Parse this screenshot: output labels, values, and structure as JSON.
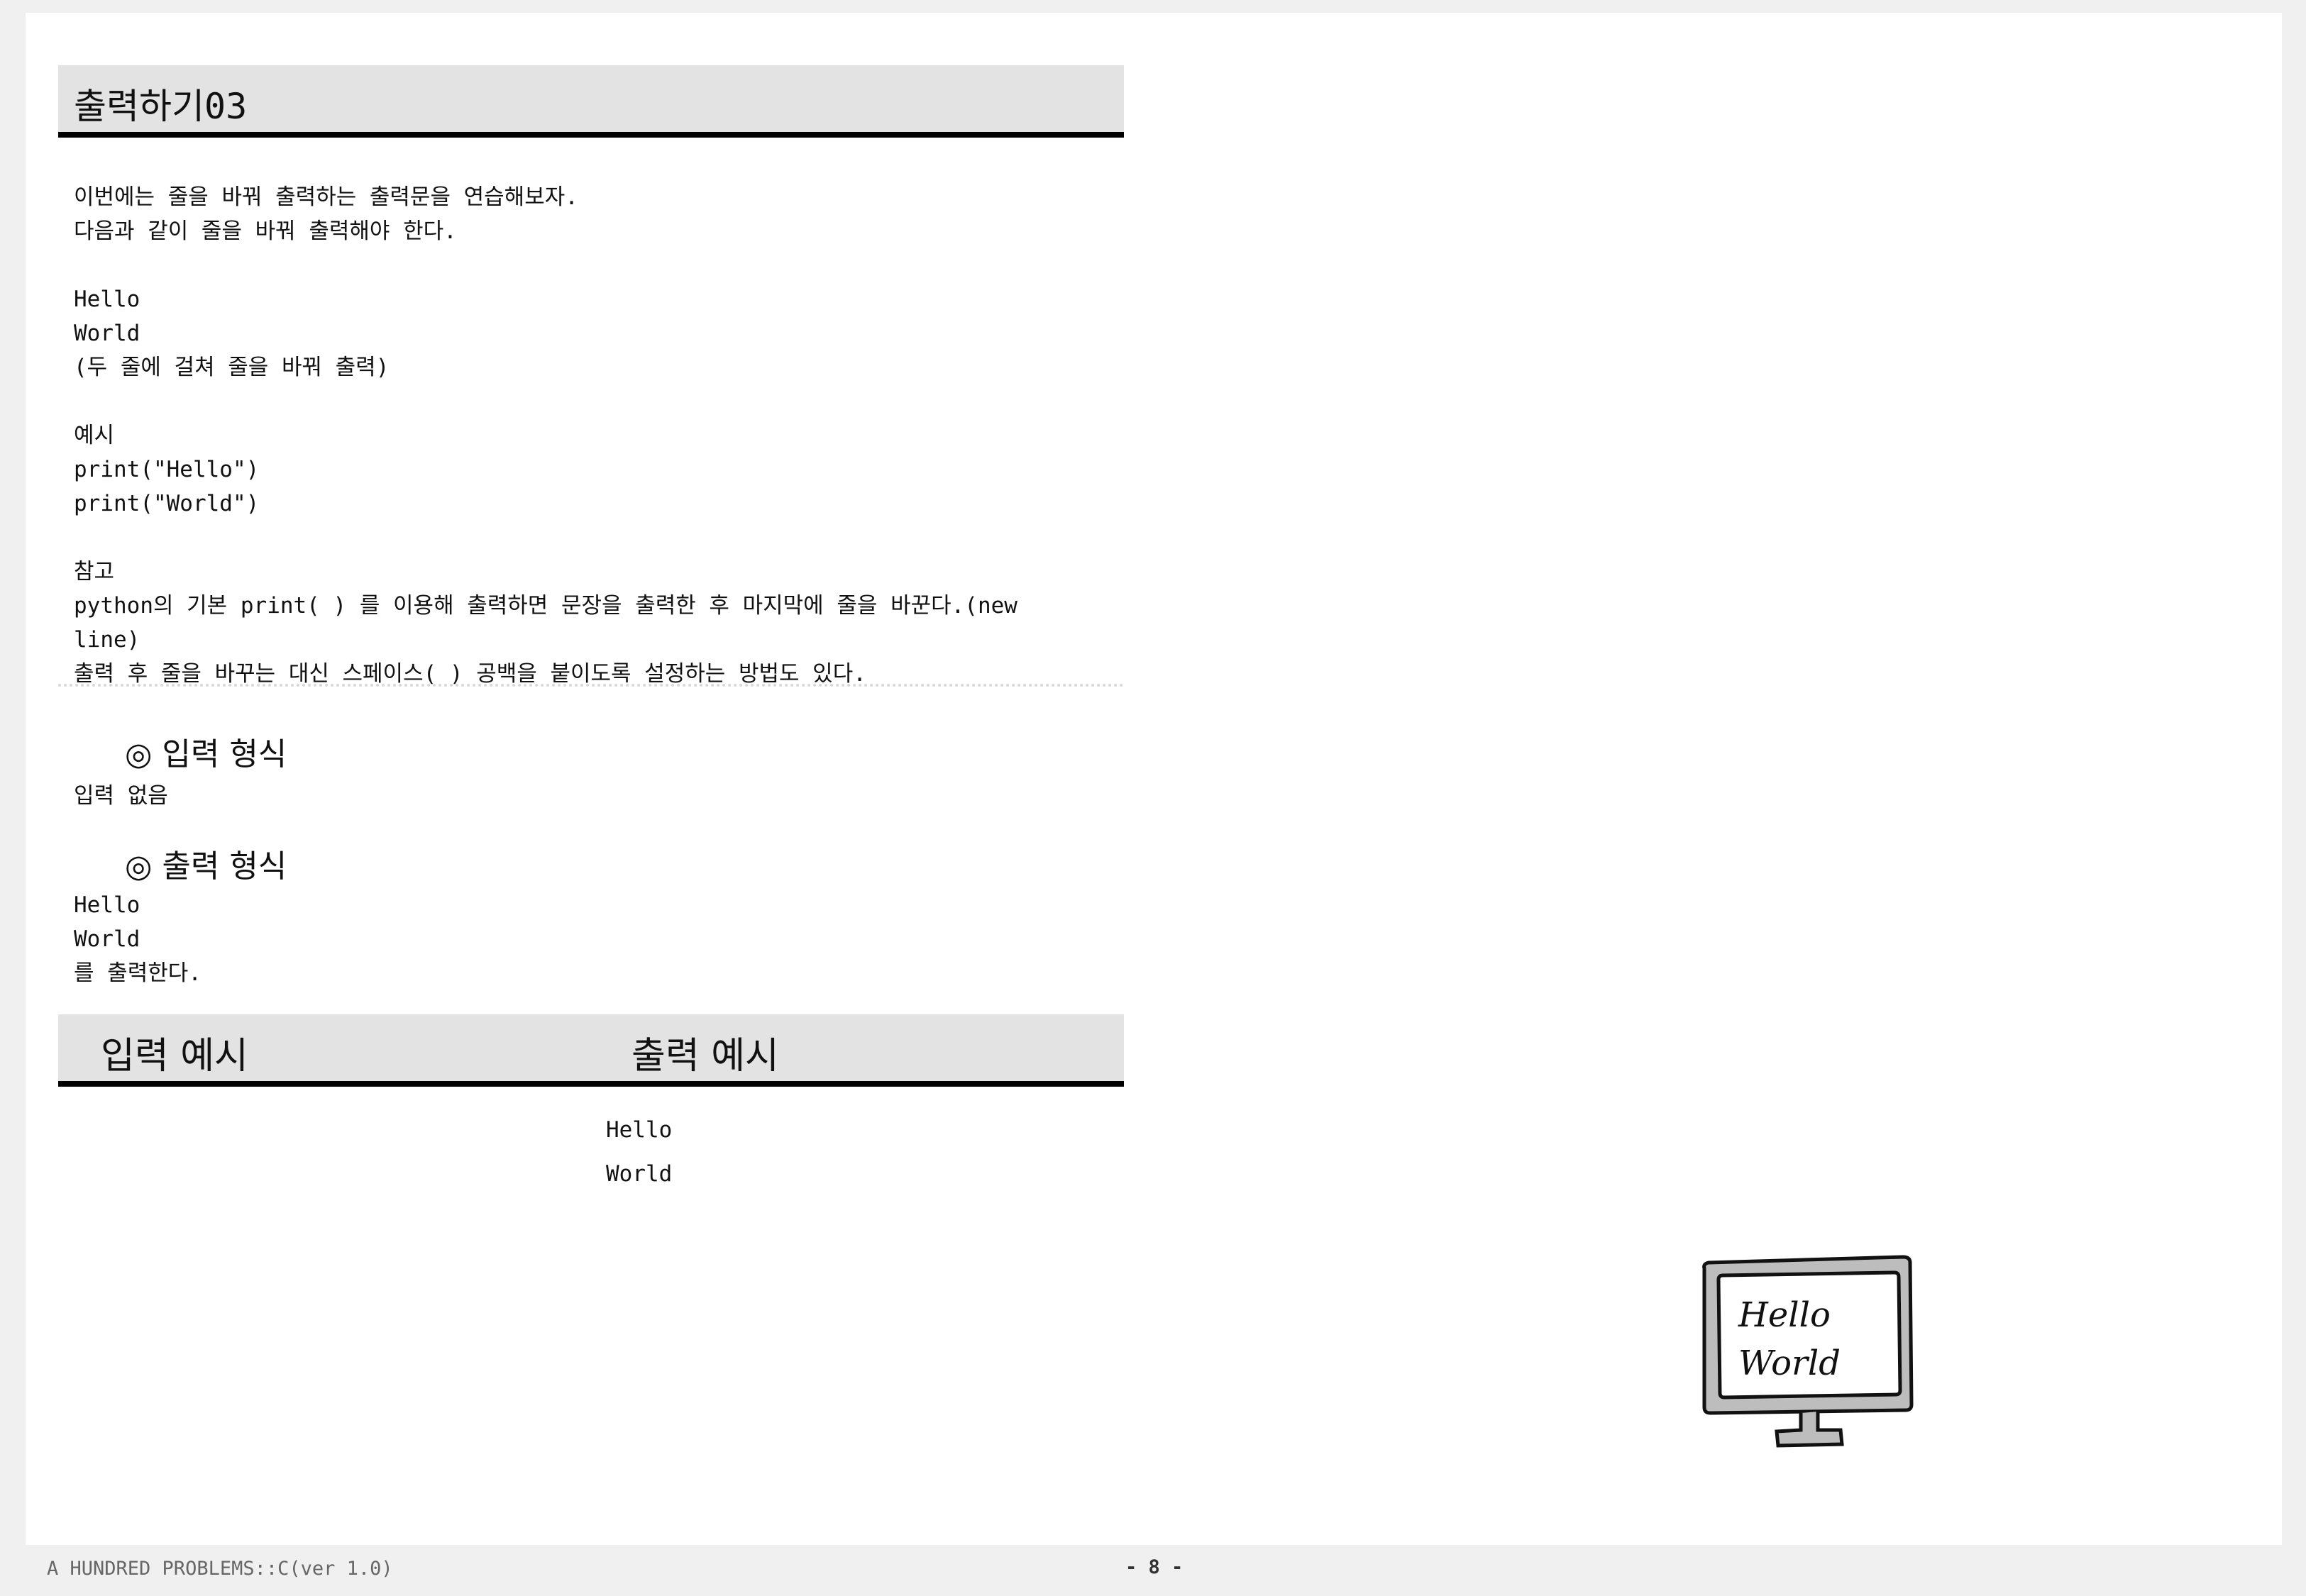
{
  "title": "출력하기03",
  "description": "이번에는 줄을 바꿔 출력하는 출력문을 연습해보자.\n다음과 같이 줄을 바꿔 출력해야 한다.\n\nHello\nWorld\n(두 줄에 걸쳐 줄을 바꿔 출력)\n\n예시\nprint(\"Hello\")\nprint(\"World\")\n\n참고\npython의 기본 print( ) 를 이용해 출력하면 문장을 출력한 후 마지막에 줄을 바꾼다.(new\nline)\n출력 후 줄을 바꾸는 대신 스페이스( ) 공백을 붙이도록 설정하는 방법도 있다.",
  "input_format": {
    "heading": "◎ 입력 형식",
    "body": "입력 없음"
  },
  "output_format": {
    "heading": "◎ 출력 형식",
    "body": "Hello\nWorld\n를 출력한다."
  },
  "examples": {
    "input_label": "입력 예시",
    "output_label": "출력 예시",
    "input_value": "",
    "output_value": "Hello\nWorld"
  },
  "illustration": {
    "line1": "Hello",
    "line2": "World"
  },
  "footer": {
    "left": "A HUNDRED PROBLEMS::C(ver 1.0)",
    "page": "- 8 -"
  }
}
